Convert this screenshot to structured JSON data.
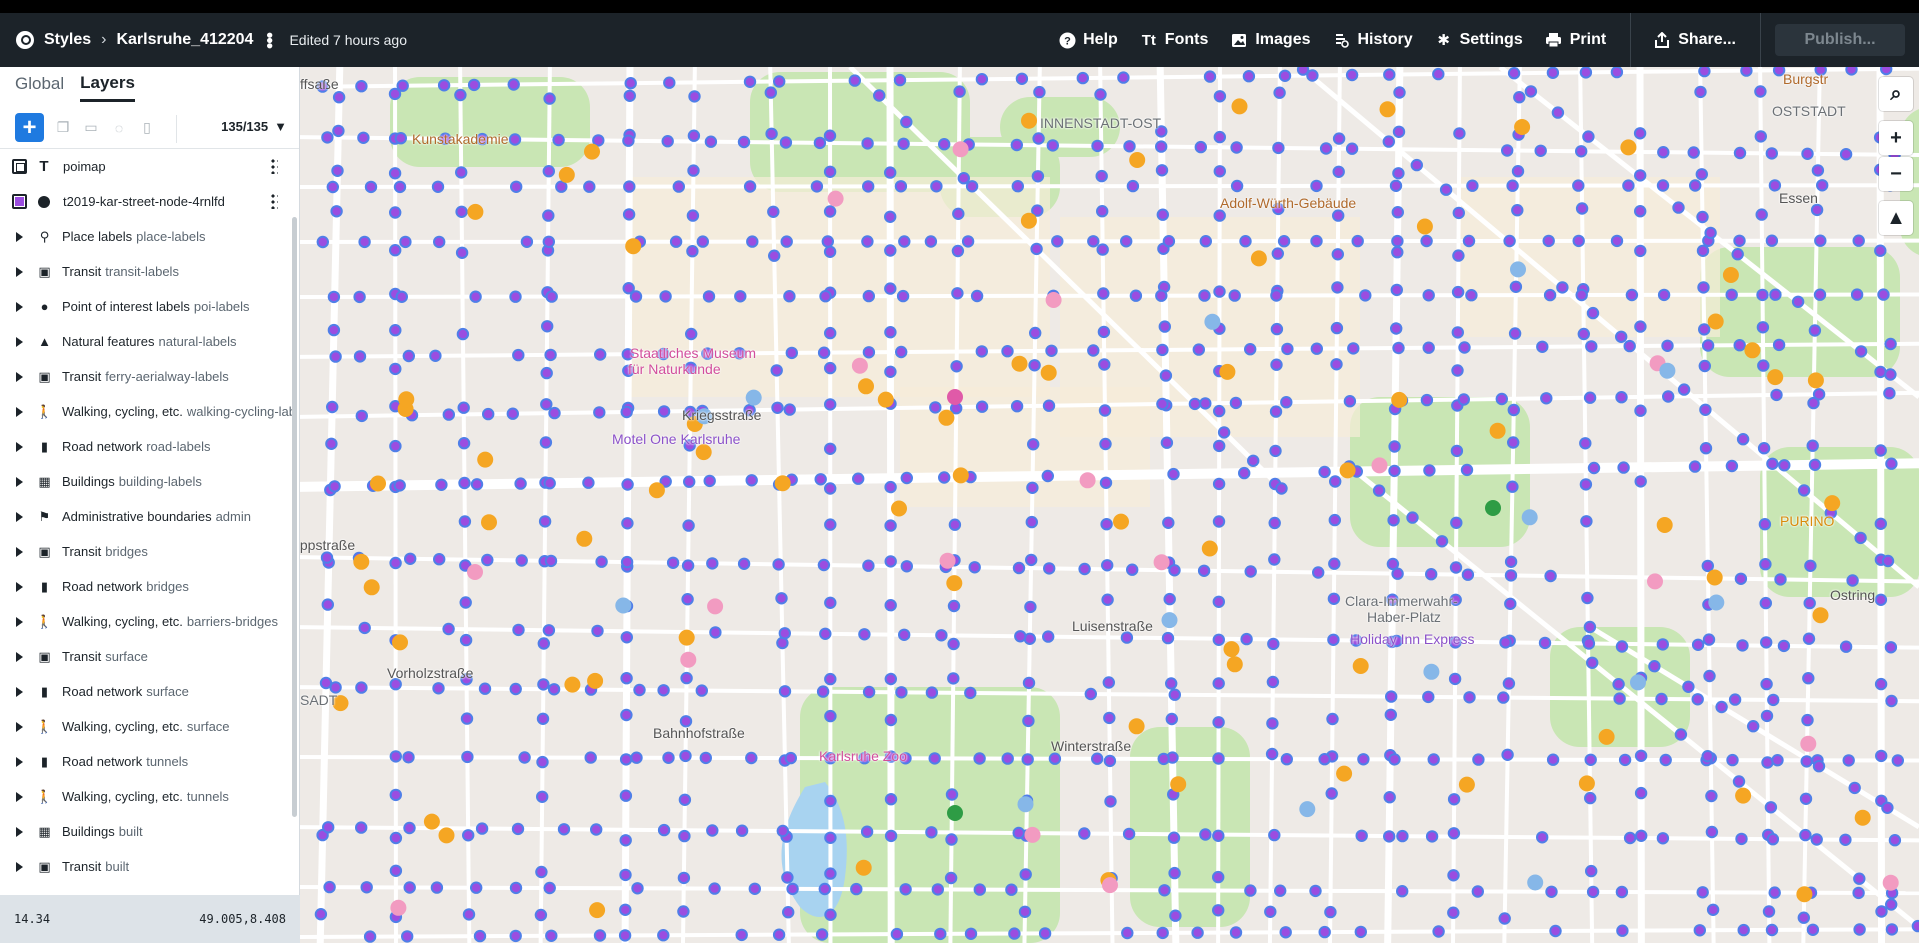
{
  "topbar": {
    "styles_label": "Styles",
    "style_name": "Karlsruhe_412204",
    "edited": "Edited 7 hours ago",
    "buttons": [
      {
        "label": "Help",
        "icon": "help-icon"
      },
      {
        "label": "Fonts",
        "icon": "fonts-icon"
      },
      {
        "label": "Images",
        "icon": "images-icon"
      },
      {
        "label": "History",
        "icon": "history-icon"
      },
      {
        "label": "Settings",
        "icon": "settings-icon"
      },
      {
        "label": "Print",
        "icon": "print-icon"
      }
    ],
    "share": "Share...",
    "publish": "Publish..."
  },
  "sidebar": {
    "tabs": [
      "Global",
      "Layers"
    ],
    "count": "135/135",
    "layers": [
      {
        "kind": "layer",
        "check": "img",
        "type": "T",
        "name": "poimap"
      },
      {
        "kind": "layer",
        "check": "purple",
        "type": "dot",
        "name": "t2019-kar-street-node-4rnlfd"
      }
    ],
    "groups": [
      {
        "name": "Place labels",
        "sub": "place-labels",
        "icon": "place-icon"
      },
      {
        "name": "Transit",
        "sub": "transit-labels",
        "icon": "transit-icon"
      },
      {
        "name": "Point of interest labels",
        "sub": "poi-labels",
        "icon": "poi-icon"
      },
      {
        "name": "Natural features",
        "sub": "natural-labels",
        "icon": "natural-icon"
      },
      {
        "name": "Transit",
        "sub": "ferry-aerialway-labels",
        "icon": "transit-icon"
      },
      {
        "name": "Walking, cycling, etc.",
        "sub": "walking-cycling-labels",
        "icon": "walking-icon"
      },
      {
        "name": "Road network",
        "sub": "road-labels",
        "icon": "road-icon"
      },
      {
        "name": "Buildings",
        "sub": "building-labels",
        "icon": "building-icon"
      },
      {
        "name": "Administrative boundaries",
        "sub": "admin",
        "icon": "admin-icon"
      },
      {
        "name": "Transit",
        "sub": "bridges",
        "icon": "transit-icon"
      },
      {
        "name": "Road network",
        "sub": "bridges",
        "icon": "road-icon"
      },
      {
        "name": "Walking, cycling, etc.",
        "sub": "barriers-bridges",
        "icon": "walking-icon"
      },
      {
        "name": "Transit",
        "sub": "surface",
        "icon": "transit-icon"
      },
      {
        "name": "Road network",
        "sub": "surface",
        "icon": "road-icon"
      },
      {
        "name": "Walking, cycling, etc.",
        "sub": "surface",
        "icon": "walking-icon"
      },
      {
        "name": "Road network",
        "sub": "tunnels",
        "icon": "road-icon"
      },
      {
        "name": "Walking, cycling, etc.",
        "sub": "tunnels",
        "icon": "walking-icon"
      },
      {
        "name": "Buildings",
        "sub": "built",
        "icon": "building-icon"
      },
      {
        "name": "Transit",
        "sub": "built",
        "icon": "transit-icon"
      }
    ],
    "zoom": "14.34",
    "coords": "49.005,8.408"
  },
  "map": {
    "labels": [
      {
        "text": "Kunstakademie",
        "color": "#b06a2c"
      },
      {
        "text": "Staatliches Museum",
        "color": "#d24e9c"
      },
      {
        "text": "für Naturkunde",
        "color": "#d24e9c"
      },
      {
        "text": "Kriegsstraße",
        "color": "#555"
      },
      {
        "text": "Motel One Karlsruhe",
        "color": "#8c52c9"
      },
      {
        "text": "Adolf-Würth-Gebäude",
        "color": "#b06a2c"
      },
      {
        "text": "OSTSTADT",
        "color": "#6b7075"
      },
      {
        "text": "INNENSTADT-OST",
        "color": "#6b7075"
      },
      {
        "text": "Clara-Immerwahr-",
        "color": "#6b7075"
      },
      {
        "text": "Haber-Platz",
        "color": "#6b7075"
      },
      {
        "text": "Holiday Inn Express",
        "color": "#8c52c9"
      },
      {
        "text": "PURINO",
        "color": "#d98b0c"
      },
      {
        "text": "Luisenstraße",
        "color": "#555"
      },
      {
        "text": "Vorholzstraße",
        "color": "#555"
      },
      {
        "text": "Winterstraße",
        "color": "#555"
      },
      {
        "text": "Bahnhofstraße",
        "color": "#555"
      },
      {
        "text": "Karlsruhe Zoo",
        "color": "#d24e9c"
      },
      {
        "text": "Essen",
        "color": "#555"
      },
      {
        "text": "Burgstr",
        "color": "#b06a2c"
      },
      {
        "text": "Ostring",
        "color": "#555"
      },
      {
        "text": "Ruppstraße",
        "color": "#555"
      },
      {
        "text": "SADT",
        "color": "#6b7075"
      },
      {
        "text": "ffsaße",
        "color": "#555"
      }
    ],
    "controls": [
      "search-icon",
      "zoom-in-icon",
      "zoom-out-icon",
      "compass-icon"
    ],
    "control_glyphs": [
      "⌕",
      "+",
      "−",
      "▲"
    ]
  },
  "colors": {
    "node_fill": "#9b4de0",
    "node_stroke": "#4f7fe8",
    "food_poi": "#f5a623",
    "park": "#c9e6b4",
    "road": "#ffffff"
  }
}
